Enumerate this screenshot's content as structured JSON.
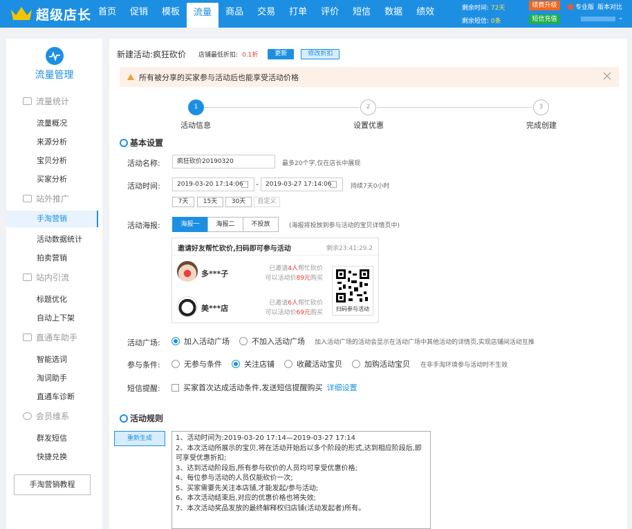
{
  "app": {
    "name": "超级店长"
  },
  "nav": [
    "首页",
    "促销",
    "模板",
    "流量",
    "商品",
    "交易",
    "打单",
    "评价",
    "短信",
    "数据",
    "绩效"
  ],
  "topright": {
    "time_label": "剩余时间:",
    "time_value": "72天",
    "sms_label": "剩余短信:",
    "sms_value": "0条",
    "renew_btn": "续费升级",
    "sms_btn": "短信充值",
    "pro_label": "专业版",
    "compare_label": "版本对比"
  },
  "sidebar": {
    "title": "流量管理",
    "groups": [
      {
        "label": "流量统计",
        "items": [
          "流量概况",
          "来源分析",
          "宝贝分析",
          "买家分析"
        ]
      },
      {
        "label": "站外推广",
        "items": [
          "手淘营销",
          "活动数据统计",
          "拍卖营销"
        ]
      },
      {
        "label": "站内引流",
        "items": [
          "标题优化",
          "自动上下架"
        ]
      },
      {
        "label": "直通车助手",
        "items": [
          "智能选词",
          "淘词助手",
          "直通车诊断"
        ]
      },
      {
        "label": "会员维系",
        "items": [
          "群发短信",
          "快捷兑换"
        ]
      }
    ],
    "tutorial": "手淘营销教程"
  },
  "header": {
    "title": "新建活动:疯狂砍价",
    "min_discount_label": "店铺最低折扣:",
    "min_discount_value": "0.1折",
    "update_btn": "更新",
    "modify_btn": "修改折扣"
  },
  "alert": "所有被分享的买家参与活动后也能享受活动价格",
  "steps": [
    {
      "num": "1",
      "label": "活动信息"
    },
    {
      "num": "2",
      "label": "设置优惠"
    },
    {
      "num": "3",
      "label": "完成创建"
    }
  ],
  "basic": {
    "section": "基本设置",
    "name_label": "活动名称:",
    "name_value": "疯狂砍价20190320",
    "name_hint": "最多20个字,仅在店长中展现",
    "time_label": "活动时间:",
    "start": "2019-03-20 17:14:06",
    "dash": "-",
    "end": "2019-03-27 17:14:06",
    "duration": "持续7天0小时",
    "quick": [
      "7天",
      "15天",
      "30天",
      "自定义"
    ],
    "poster_label": "活动海报:",
    "poster_tabs": [
      "海报一",
      "海报二",
      "不投放"
    ],
    "poster_hint": "(海报将投放到参与活动的宝贝详情页中)",
    "poster": {
      "heading": "邀请好友帮忙砍价,扫码即可参与活动",
      "countdown": "剩余23:41:29.2",
      "rows": [
        {
          "name": "多***子",
          "inv_pre": "已邀请",
          "inv_num": "4人",
          "inv_post": "帮忙砍价",
          "price_pre": "可以活动价",
          "price": "89元",
          "price_post": "购买"
        },
        {
          "name": "美***店",
          "inv_pre": "已邀请",
          "inv_num": "6人",
          "inv_post": "帮忙砍价",
          "price_pre": "可以活动价",
          "price": "69元",
          "price_post": "购买"
        }
      ],
      "qr_caption": "扫码参与活动"
    },
    "plaza_label": "活动广场:",
    "plaza_opts": [
      "加入活动广场",
      "不加入活动广场"
    ],
    "plaza_hint": "加入活动广场的活动会显示在活动广场中其他活动的详情页,实现店铺间活动互推",
    "cond_label": "参与条件:",
    "cond_opts": [
      "无参与条件",
      "关注店铺",
      "收藏活动宝贝",
      "加购活动宝贝"
    ],
    "cond_hint": "在非手淘环境参与活动时不生效",
    "sms_label": "短信提醒:",
    "sms_text": "买家首次达成活动条件,发送短信提醒购买",
    "sms_link": "详细设置"
  },
  "rules": {
    "section": "活动规则",
    "regen_btn": "重新生成",
    "lines": [
      "1、活动时间为:2019-03-20 17:14—2019-03-27 17:14",
      "2、本次活动所展示的宝贝,将在活动开始后以多个阶段的形式,达到相应阶段后,即可享受优惠折扣;",
      "3、达到活动阶段后,所有参与砍价的人员均可享受优惠价格;",
      "4、每位参与活动的人员仅能砍价一次;",
      "5、买家需要先关注本店铺,才能发起/参与活动;",
      "6、本次活动结束后,对应的优惠价格也将失效;",
      "7、本次活动奖品发放的最终解释权归店铺(活动发起者)所有。"
    ]
  }
}
